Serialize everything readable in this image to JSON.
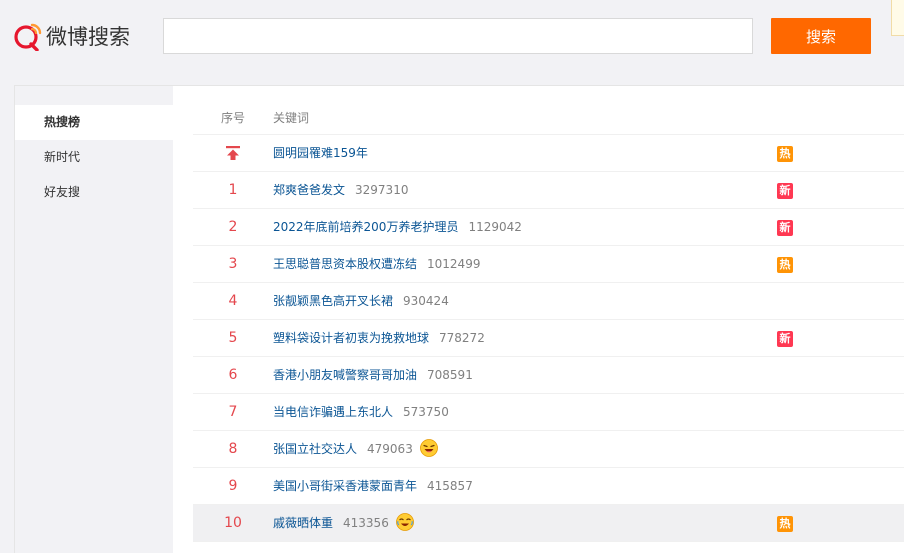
{
  "header": {
    "logo_text": "微博搜索",
    "search_value": "",
    "search_button": "搜索"
  },
  "sidebar": {
    "items": [
      {
        "label": "热搜榜",
        "active": true
      },
      {
        "label": "新时代",
        "active": false
      },
      {
        "label": "好友搜",
        "active": false
      }
    ]
  },
  "list": {
    "col_rank": "序号",
    "col_keyword": "关键词",
    "rows": [
      {
        "rank": "",
        "pinned": true,
        "keyword": "圆明园罹难159年",
        "count": "",
        "badge": "热",
        "badge_color": "#ff9406",
        "emoji": ""
      },
      {
        "rank": "1",
        "keyword": "郑爽爸爸发文",
        "count": "3297310",
        "badge": "新",
        "badge_color": "#ff3852",
        "emoji": ""
      },
      {
        "rank": "2",
        "keyword": "2022年底前培养200万养老护理员",
        "count": "1129042",
        "badge": "新",
        "badge_color": "#ff3852",
        "emoji": ""
      },
      {
        "rank": "3",
        "keyword": "王思聪普思资本股权遭冻结",
        "count": "1012499",
        "badge": "热",
        "badge_color": "#ff9406",
        "emoji": ""
      },
      {
        "rank": "4",
        "keyword": "张靓颖黑色高开叉长裙",
        "count": "930424",
        "badge": "",
        "badge_color": "",
        "emoji": ""
      },
      {
        "rank": "5",
        "keyword": "塑料袋设计者初衷为挽救地球",
        "count": "778272",
        "badge": "新",
        "badge_color": "#ff3852",
        "emoji": ""
      },
      {
        "rank": "6",
        "keyword": "香港小朋友喊警察哥哥加油",
        "count": "708591",
        "badge": "",
        "badge_color": "",
        "emoji": ""
      },
      {
        "rank": "7",
        "keyword": "当电信诈骗遇上东北人",
        "count": "573750",
        "badge": "",
        "badge_color": "",
        "emoji": ""
      },
      {
        "rank": "8",
        "keyword": "张国立社交达人",
        "count": "479063",
        "badge": "",
        "badge_color": "",
        "emoji": "laughing-emoji"
      },
      {
        "rank": "9",
        "keyword": "美国小哥街采香港蒙面青年",
        "count": "415857",
        "badge": "",
        "badge_color": "",
        "emoji": ""
      },
      {
        "rank": "10",
        "keyword": "戚薇晒体重",
        "count": "413356",
        "badge": "热",
        "badge_color": "#ff9406",
        "emoji": "tearful-laugh-emoji"
      }
    ]
  },
  "colors": {
    "accent": "#ff6800",
    "rank_red": "#e4474d",
    "link_blue": "#0b5594"
  }
}
